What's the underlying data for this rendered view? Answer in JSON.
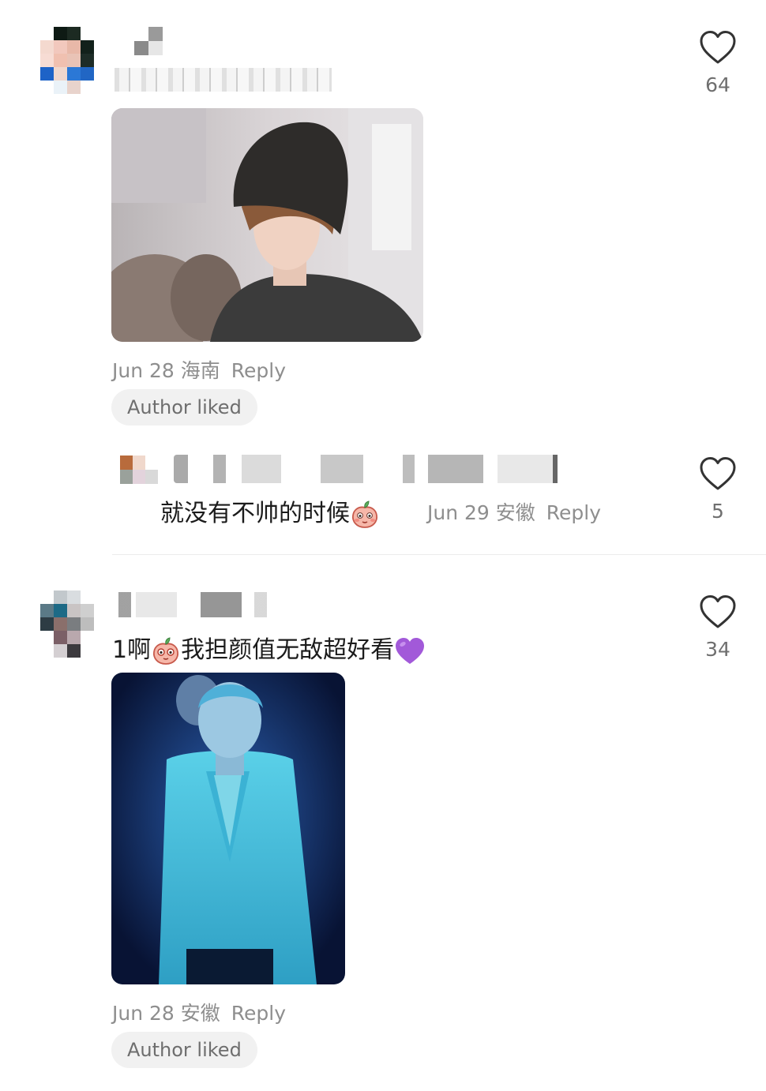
{
  "comments": [
    {
      "like_count": "64",
      "date": "Jun 28",
      "location": "海南",
      "reply_label": "Reply",
      "author_liked_label": "Author liked",
      "reply_thread": {
        "text": "就没有不帅的时候",
        "emoji": "peach-shy-emoji",
        "date": "Jun 29",
        "location": "安徽",
        "reply_label": "Reply",
        "like_count": "5"
      }
    },
    {
      "text": "1啊",
      "text_after_emoji": "我担颜值无敌超好看",
      "emoji": "peach-shy-emoji",
      "trailing_emoji": "purple-heart-emoji",
      "like_count": "34",
      "date": "Jun 28",
      "location": "安徽",
      "reply_label": "Reply",
      "author_liked_label": "Author liked"
    }
  ],
  "icons": {
    "like": "heart-outline-icon"
  },
  "colors": {
    "meta_text": "#8e8e8e",
    "chip_bg": "#f1f1f1",
    "purple_heart": "#a259d9"
  }
}
